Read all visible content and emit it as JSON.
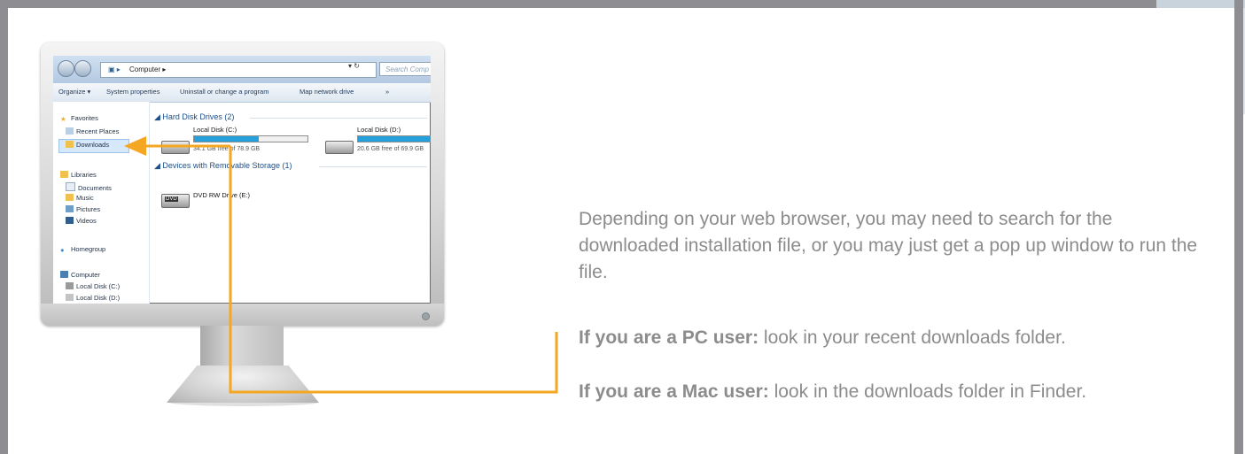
{
  "explorer": {
    "breadcrumb": "Computer  ▸",
    "search_placeholder": "Search Comp",
    "toolbar": [
      "Organize ▾",
      "System properties",
      "Uninstall or change a program",
      "Map network drive",
      "»"
    ],
    "sidebar": {
      "favorites_label": "Favorites",
      "favorites": [
        "Recent Places",
        "Downloads"
      ],
      "libraries_label": "Libraries",
      "libraries": [
        "Documents",
        "Music",
        "Pictures",
        "Videos"
      ],
      "homegroup_label": "Homegroup",
      "computer_label": "Computer",
      "computer_items": [
        "Local Disk (C:)",
        "Local Disk (D:)"
      ]
    },
    "hard_disk_group": "◢ Hard Disk Drives (2)",
    "drives": [
      {
        "name": "Local Disk (C:)",
        "free": "34.1 GB free of 78.9 GB",
        "used_fraction": 0.57
      },
      {
        "name": "Local Disk (D:)",
        "free": "20.6 GB free of 69.9 GB",
        "used_fraction": 0.71
      }
    ],
    "removable_group": "◢ Devices with Removable Storage (1)",
    "dvd_name": "DVD RW Drive (E:)"
  },
  "colors": {
    "arrow": "#f5a623",
    "frame": "#8e8e92",
    "text": "#8c8c8c",
    "bar_fill": "#26a0da"
  },
  "instructions": {
    "intro": "Depending on your web browser, you may need to search for the downloaded installation file, or you may just get a pop up window to run the file.",
    "pc_label": "If you are a PC user:",
    "pc_text": " look in your recent downloads folder.",
    "mac_label": "If you are a Mac user:",
    "mac_text": " look in the downloads folder in Finder."
  }
}
